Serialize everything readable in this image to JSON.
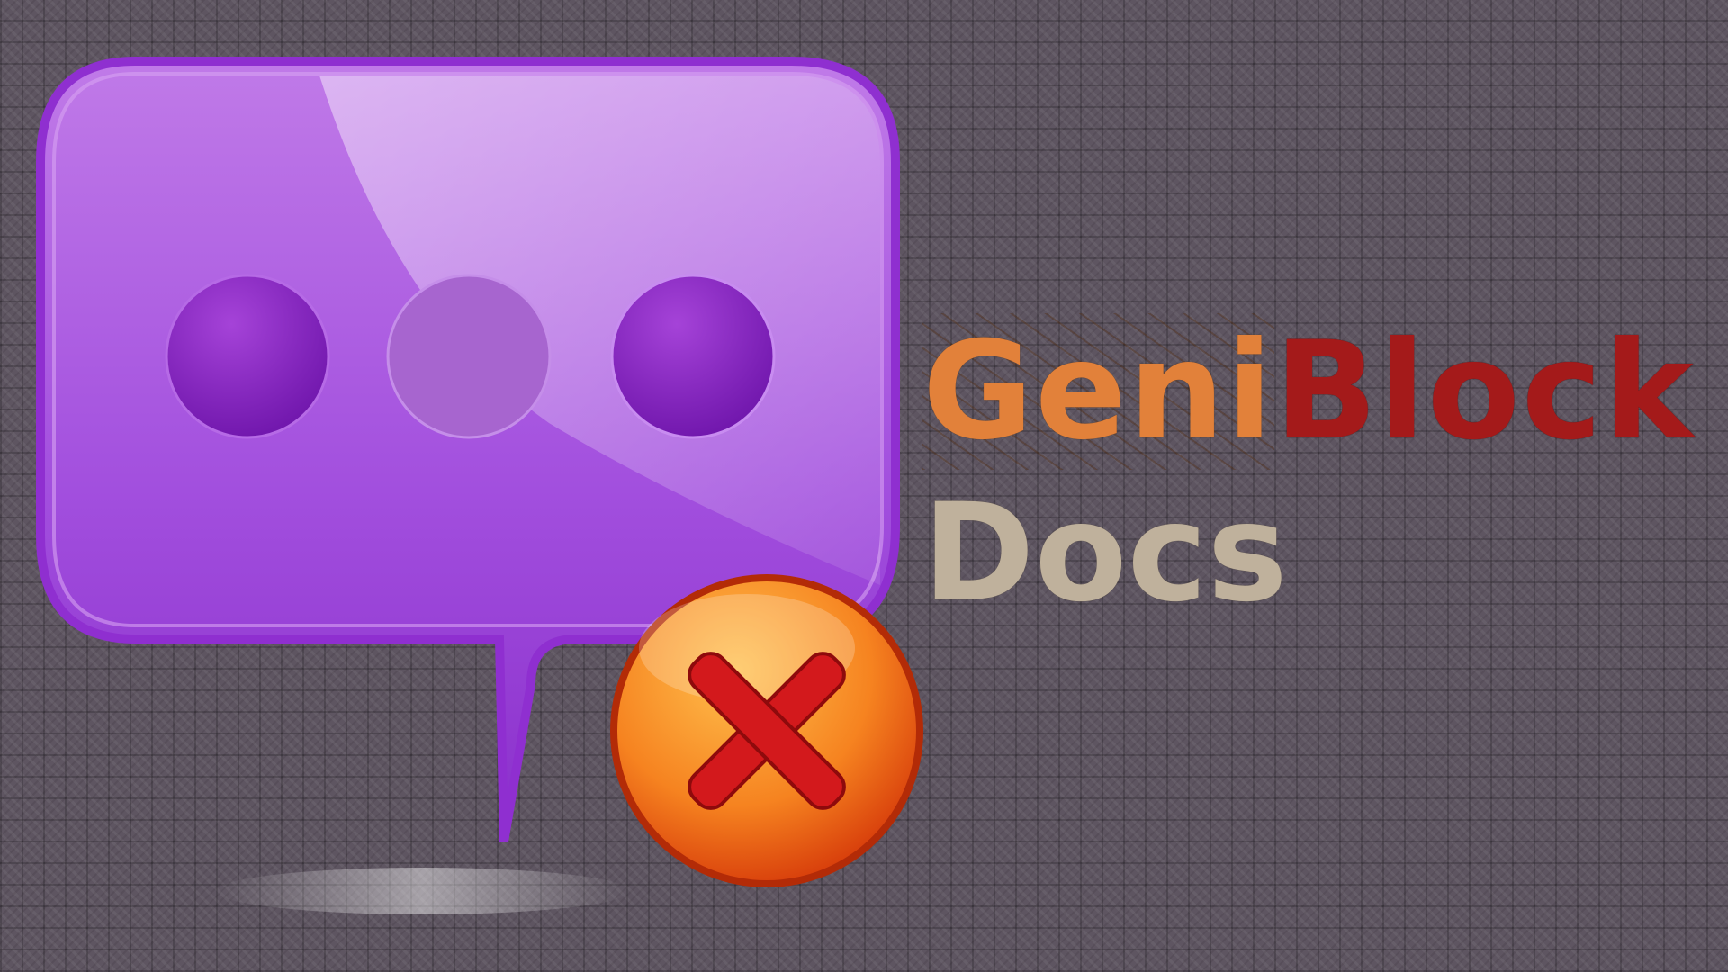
{
  "logo": {
    "part1": "Geni",
    "part2": "Block",
    "subtitle": "Docs"
  },
  "icons": {
    "main": "chat-bubble-icon",
    "typing": "ellipsis-dots-icon",
    "badge": "close-x-icon"
  },
  "colors": {
    "bubble": "#a24fde",
    "bubble_dark": "#7d25bf",
    "geni": "#e2813a",
    "block": "#a41a1a",
    "docs": "#bfb19c",
    "badge": "#f25a12",
    "x_mark": "#d3191c"
  }
}
